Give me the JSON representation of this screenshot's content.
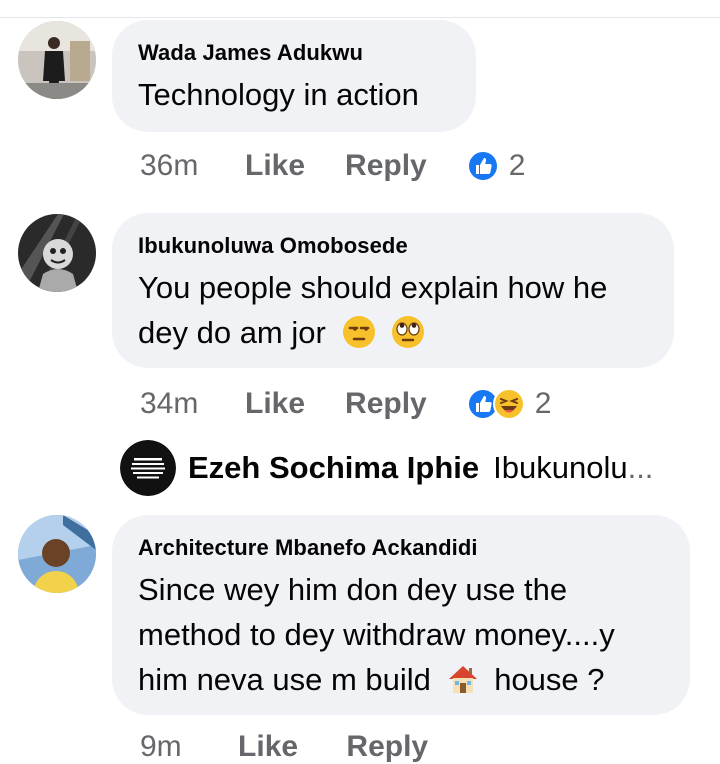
{
  "comments": [
    {
      "author": "Wada James Adukwu",
      "text": "Technology in action",
      "time": "36m",
      "like_label": "Like",
      "reply_label": "Reply",
      "reaction_count": "2",
      "reactions": [
        "like-icon"
      ]
    },
    {
      "author": "Ibukunoluwa Omobosede",
      "text_line1": "You people should explain how he",
      "text_line2": "dey do am jor",
      "emojis": [
        "unamused-face-emoji",
        "rolling-eyes-emoji"
      ],
      "time": "34m",
      "like_label": "Like",
      "reply_label": "Reply",
      "reaction_count": "2",
      "reactions": [
        "like-icon",
        "haha-icon"
      ]
    },
    {
      "author": "Architecture Mbanefo Ackandidi",
      "text_line1": "Since wey him don dey use the",
      "text_line2": "method to dey withdraw money....y",
      "text_line3_a": "him neva use m build",
      "text_line3_emoji": "house-emoji",
      "text_line3_b": "house ?",
      "time": "9m",
      "like_label": "Like",
      "reply_label": "Reply"
    }
  ],
  "reply_preview": {
    "name": "Ezeh Sochima Iphie",
    "text": "Ibukunolu",
    "ellipsis": "..."
  },
  "colors": {
    "bubble": "#f0f2f5",
    "meta": "#65676b",
    "like_blue": "#1877f2",
    "text": "#050505"
  }
}
